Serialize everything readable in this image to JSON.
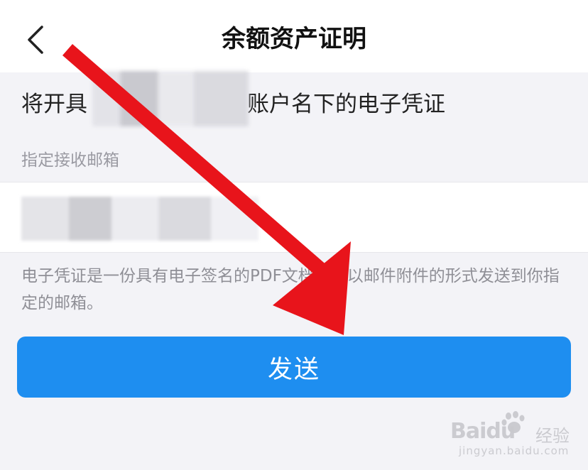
{
  "header": {
    "title": "余额资产证明",
    "back_icon": "chevron-left-icon"
  },
  "certificate": {
    "notice_prefix": "将开具",
    "notice_suffix": "账户名下的电子凭证"
  },
  "email": {
    "label": "指定接收邮箱",
    "value": ""
  },
  "description": "电子凭证是一份具有电子签名的PDF文档，将以邮件附件的形式发送到你指定的邮箱。",
  "actions": {
    "send_label": "发送"
  },
  "watermark": {
    "brand": "Baidu",
    "brand_cn": "经验",
    "url": "jingyan.baidu.com"
  },
  "colors": {
    "primary": "#1e8ef0",
    "arrow": "#e8141b",
    "background": "#f3f3f7"
  }
}
